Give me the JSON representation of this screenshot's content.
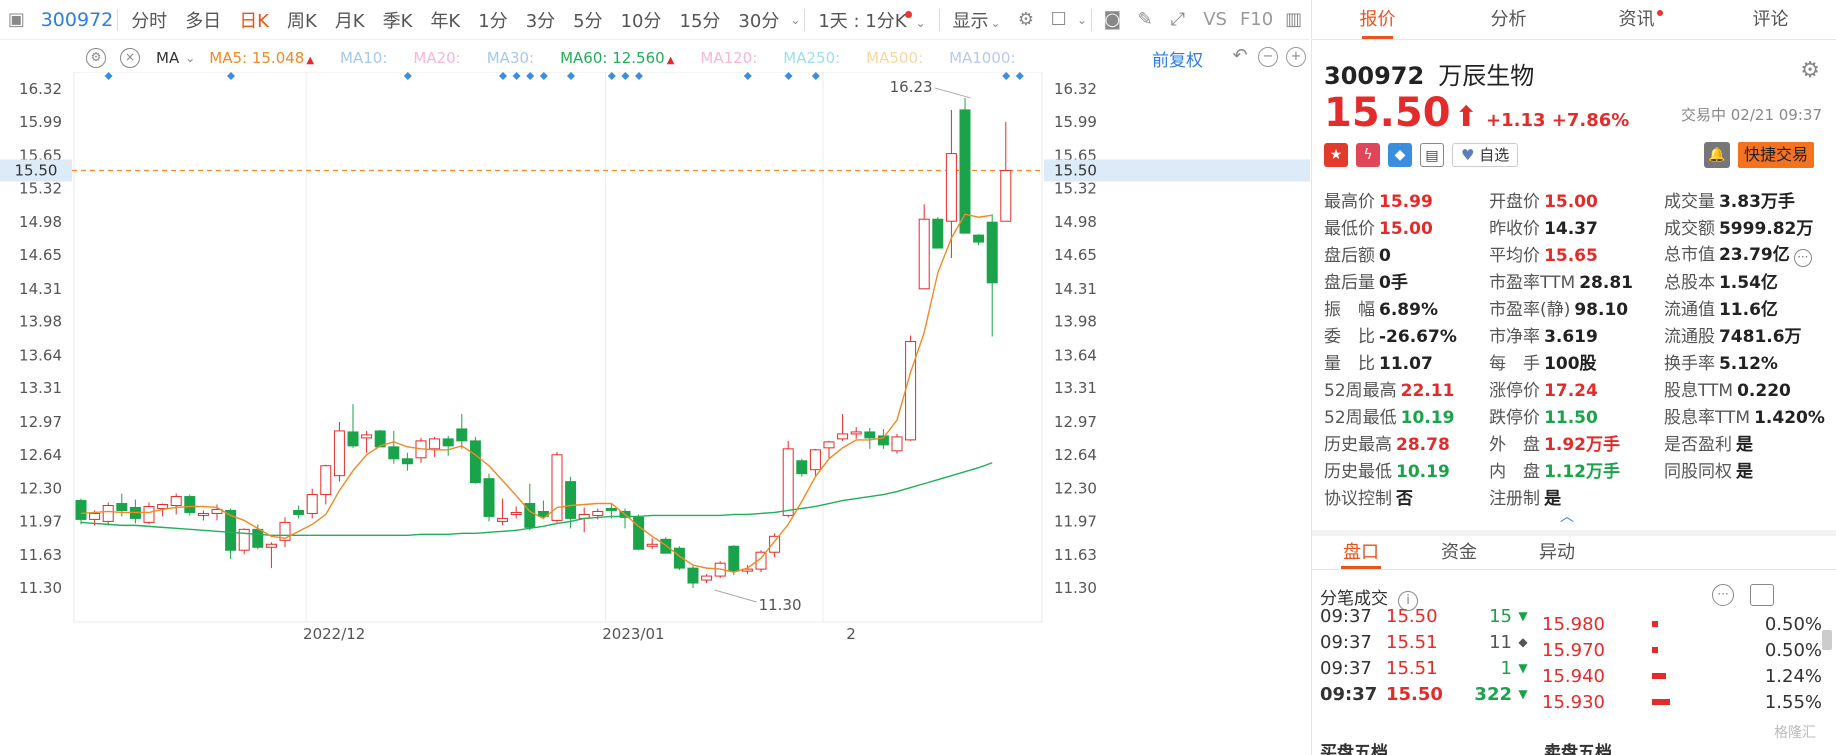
{
  "toolbar": {
    "code": "300972",
    "periods": [
      "分时",
      "多日",
      "日K",
      "周K",
      "月K",
      "季K",
      "年K",
      "1分",
      "3分",
      "5分",
      "10分",
      "15分",
      "30分"
    ],
    "active_period": "日K",
    "range_label": "1天 : 1分K",
    "display_label": "显示",
    "vs_label": "VS",
    "f10_label": "F10"
  },
  "ma_bar": {
    "name": "MA",
    "items": [
      {
        "label": "MA5:",
        "value": "15.048",
        "color": "#f08a24",
        "arrow": "▲"
      },
      {
        "label": "MA10:",
        "value": "",
        "color": "#a6c8f0",
        "arrow": ""
      },
      {
        "label": "MA20:",
        "value": "",
        "color": "#f5b8d8",
        "arrow": ""
      },
      {
        "label": "MA30:",
        "value": "",
        "color": "#a6c8f0",
        "arrow": ""
      },
      {
        "label": "MA60:",
        "value": "12.560",
        "color": "#20b05a",
        "arrow": "▲"
      },
      {
        "label": "MA120:",
        "value": "",
        "color": "#f5b8d8",
        "arrow": ""
      },
      {
        "label": "MA250:",
        "value": "",
        "color": "#9ee0e8",
        "arrow": ""
      },
      {
        "label": "MA500:",
        "value": "",
        "color": "#f5d8a0",
        "arrow": ""
      },
      {
        "label": "MA1000:",
        "value": "",
        "color": "#b8c8f0",
        "arrow": ""
      }
    ],
    "adjust_label": "前复权"
  },
  "chart_data": {
    "type": "candlestick",
    "y_ticks": [
      "16.32",
      "15.99",
      "15.65",
      "15.32",
      "14.98",
      "14.65",
      "14.31",
      "13.98",
      "13.64",
      "13.31",
      "12.97",
      "12.64",
      "12.30",
      "11.97",
      "11.63",
      "11.30"
    ],
    "ylim": [
      11.1,
      16.5
    ],
    "x_labels": [
      {
        "label": "2022/12",
        "index": 17
      },
      {
        "label": "2023/01",
        "index": 39
      },
      {
        "label": "2",
        "index": 55
      }
    ],
    "current_price": "15.50",
    "high_marker": {
      "label": "16.23",
      "index": 66,
      "value": 16.23
    },
    "low_marker": {
      "label": "11.30",
      "index": 46,
      "value": 11.3
    },
    "candles": [
      {
        "o": 12.18,
        "h": 12.2,
        "l": 11.94,
        "c": 11.99
      },
      {
        "o": 11.99,
        "h": 12.08,
        "l": 11.93,
        "c": 12.05
      },
      {
        "o": 11.97,
        "h": 12.16,
        "l": 11.93,
        "c": 12.13
      },
      {
        "o": 12.15,
        "h": 12.25,
        "l": 12.02,
        "c": 12.08
      },
      {
        "o": 12.11,
        "h": 12.19,
        "l": 11.95,
        "c": 12.0
      },
      {
        "o": 11.96,
        "h": 12.16,
        "l": 11.94,
        "c": 12.12
      },
      {
        "o": 12.1,
        "h": 12.15,
        "l": 12.02,
        "c": 12.14
      },
      {
        "o": 12.13,
        "h": 12.25,
        "l": 12.04,
        "c": 12.22
      },
      {
        "o": 12.22,
        "h": 12.24,
        "l": 12.03,
        "c": 12.06
      },
      {
        "o": 12.03,
        "h": 12.08,
        "l": 11.98,
        "c": 12.05
      },
      {
        "o": 12.05,
        "h": 12.14,
        "l": 11.98,
        "c": 12.09
      },
      {
        "o": 12.08,
        "h": 12.1,
        "l": 11.59,
        "c": 11.68
      },
      {
        "o": 11.68,
        "h": 11.9,
        "l": 11.64,
        "c": 11.89
      },
      {
        "o": 11.89,
        "h": 11.94,
        "l": 11.69,
        "c": 11.71
      },
      {
        "o": 11.71,
        "h": 11.76,
        "l": 11.5,
        "c": 11.74
      },
      {
        "o": 11.78,
        "h": 12.01,
        "l": 11.71,
        "c": 11.96
      },
      {
        "o": 12.08,
        "h": 12.13,
        "l": 12.0,
        "c": 12.04
      },
      {
        "o": 12.05,
        "h": 12.3,
        "l": 12.0,
        "c": 12.24
      },
      {
        "o": 12.24,
        "h": 12.54,
        "l": 12.14,
        "c": 12.53
      },
      {
        "o": 12.43,
        "h": 12.97,
        "l": 12.37,
        "c": 12.88
      },
      {
        "o": 12.87,
        "h": 13.15,
        "l": 12.71,
        "c": 12.73
      },
      {
        "o": 12.81,
        "h": 12.88,
        "l": 12.66,
        "c": 12.84
      },
      {
        "o": 12.88,
        "h": 12.89,
        "l": 12.72,
        "c": 12.72
      },
      {
        "o": 12.72,
        "h": 12.88,
        "l": 12.55,
        "c": 12.6
      },
      {
        "o": 12.6,
        "h": 12.66,
        "l": 12.48,
        "c": 12.55
      },
      {
        "o": 12.61,
        "h": 12.81,
        "l": 12.56,
        "c": 12.78
      },
      {
        "o": 12.7,
        "h": 12.82,
        "l": 12.62,
        "c": 12.8
      },
      {
        "o": 12.8,
        "h": 12.83,
        "l": 12.63,
        "c": 12.73
      },
      {
        "o": 12.9,
        "h": 13.05,
        "l": 12.7,
        "c": 12.78
      },
      {
        "o": 12.78,
        "h": 12.82,
        "l": 12.35,
        "c": 12.36
      },
      {
        "o": 12.4,
        "h": 12.45,
        "l": 11.97,
        "c": 12.02
      },
      {
        "o": 11.97,
        "h": 12.2,
        "l": 11.93,
        "c": 12.0
      },
      {
        "o": 12.04,
        "h": 12.12,
        "l": 12.0,
        "c": 12.06
      },
      {
        "o": 12.15,
        "h": 12.35,
        "l": 11.88,
        "c": 11.91
      },
      {
        "o": 12.07,
        "h": 12.18,
        "l": 12.0,
        "c": 12.02
      },
      {
        "o": 11.98,
        "h": 12.67,
        "l": 11.96,
        "c": 12.64
      },
      {
        "o": 12.37,
        "h": 12.42,
        "l": 11.9,
        "c": 12.0
      },
      {
        "o": 12.0,
        "h": 12.11,
        "l": 11.86,
        "c": 12.04
      },
      {
        "o": 12.03,
        "h": 12.1,
        "l": 11.99,
        "c": 12.07
      },
      {
        "o": 12.1,
        "h": 12.15,
        "l": 12.0,
        "c": 12.08
      },
      {
        "o": 12.07,
        "h": 12.1,
        "l": 11.9,
        "c": 12.01
      },
      {
        "o": 12.01,
        "h": 12.04,
        "l": 11.68,
        "c": 11.69
      },
      {
        "o": 11.72,
        "h": 11.8,
        "l": 11.69,
        "c": 11.74
      },
      {
        "o": 11.79,
        "h": 11.81,
        "l": 11.65,
        "c": 11.65
      },
      {
        "o": 11.7,
        "h": 11.72,
        "l": 11.48,
        "c": 11.5
      },
      {
        "o": 11.5,
        "h": 11.53,
        "l": 11.3,
        "c": 11.35
      },
      {
        "o": 11.38,
        "h": 11.44,
        "l": 11.35,
        "c": 11.42
      },
      {
        "o": 11.42,
        "h": 11.57,
        "l": 11.4,
        "c": 11.55
      },
      {
        "o": 11.72,
        "h": 11.73,
        "l": 11.43,
        "c": 11.47
      },
      {
        "o": 11.47,
        "h": 11.53,
        "l": 11.44,
        "c": 11.49
      },
      {
        "o": 11.49,
        "h": 11.68,
        "l": 11.46,
        "c": 11.66
      },
      {
        "o": 11.66,
        "h": 11.85,
        "l": 11.61,
        "c": 11.82
      },
      {
        "o": 12.03,
        "h": 12.78,
        "l": 12.01,
        "c": 12.7
      },
      {
        "o": 12.58,
        "h": 12.6,
        "l": 12.42,
        "c": 12.45
      },
      {
        "o": 12.49,
        "h": 12.7,
        "l": 12.43,
        "c": 12.69
      },
      {
        "o": 12.71,
        "h": 12.78,
        "l": 12.6,
        "c": 12.77
      },
      {
        "o": 12.8,
        "h": 13.05,
        "l": 12.78,
        "c": 12.85
      },
      {
        "o": 12.85,
        "h": 12.92,
        "l": 12.8,
        "c": 12.87
      },
      {
        "o": 12.87,
        "h": 12.91,
        "l": 12.7,
        "c": 12.81
      },
      {
        "o": 12.83,
        "h": 12.9,
        "l": 12.7,
        "c": 12.74
      },
      {
        "o": 12.68,
        "h": 12.85,
        "l": 12.65,
        "c": 12.82
      },
      {
        "o": 12.79,
        "h": 13.84,
        "l": 12.78,
        "c": 13.78
      },
      {
        "o": 14.31,
        "h": 15.16,
        "l": 14.31,
        "c": 15.01
      },
      {
        "o": 15.01,
        "h": 15.03,
        "l": 14.73,
        "c": 14.72
      },
      {
        "o": 14.99,
        "h": 16.11,
        "l": 14.62,
        "c": 15.67
      },
      {
        "o": 16.11,
        "h": 16.23,
        "l": 14.87,
        "c": 14.87
      },
      {
        "o": 14.85,
        "h": 14.86,
        "l": 14.75,
        "c": 14.78
      },
      {
        "o": 14.98,
        "h": 15.06,
        "l": 13.83,
        "c": 14.37
      },
      {
        "o": 14.99,
        "h": 15.99,
        "l": 15.0,
        "c": 15.5
      }
    ],
    "ma5": [
      12.05,
      12.06,
      12.07,
      12.06,
      12.06,
      12.06,
      12.09,
      12.11,
      12.12,
      12.12,
      12.11,
      12.03,
      11.98,
      11.9,
      11.82,
      11.8,
      11.87,
      11.94,
      12.04,
      12.28,
      12.48,
      12.64,
      12.73,
      12.77,
      12.72,
      12.7,
      12.69,
      12.69,
      12.73,
      12.64,
      12.53,
      12.38,
      12.23,
      12.07,
      12.0,
      12.11,
      12.13,
      12.14,
      12.15,
      12.15,
      12.04,
      11.92,
      11.82,
      11.73,
      11.62,
      11.53,
      11.5,
      11.49,
      11.46,
      11.5,
      11.6,
      11.77,
      11.94,
      12.17,
      12.42,
      12.6,
      12.71,
      12.79,
      12.79,
      12.81,
      12.99,
      13.47,
      13.87,
      14.47,
      14.82,
      15.06,
      15.03,
      15.05
    ],
    "ma60": [
      11.96,
      11.95,
      11.94,
      11.93,
      11.93,
      11.92,
      11.91,
      11.9,
      11.89,
      11.88,
      11.87,
      11.86,
      11.85,
      11.84,
      11.83,
      11.83,
      11.83,
      11.83,
      11.83,
      11.83,
      11.83,
      11.83,
      11.83,
      11.83,
      11.83,
      11.84,
      11.84,
      11.84,
      11.85,
      11.85,
      11.86,
      11.87,
      11.88,
      11.9,
      11.92,
      11.95,
      11.97,
      12.0,
      12.01,
      12.02,
      12.02,
      12.02,
      12.03,
      12.03,
      12.03,
      12.03,
      12.03,
      12.03,
      12.04,
      12.04,
      12.05,
      12.06,
      12.08,
      12.1,
      12.12,
      12.15,
      12.18,
      12.2,
      12.22,
      12.24,
      12.27,
      12.31,
      12.35,
      12.39,
      12.43,
      12.47,
      12.51,
      12.56
    ],
    "marker_indices": [
      1,
      10,
      23,
      30,
      31,
      32,
      33,
      35,
      38,
      39,
      40,
      48,
      51,
      53,
      67,
      68
    ]
  },
  "panel": {
    "tabs": [
      "报价",
      "分析",
      "资讯",
      "评论"
    ],
    "active_tab": "报价",
    "code": "300972",
    "name": "万辰生物",
    "price": "15.50",
    "change": "+1.13",
    "change_pct": "+7.86%",
    "status": "交易中 02/21 09:37",
    "watch_label": "自选",
    "fast_trade": "快捷交易",
    "quote_rows": [
      [
        {
          "l": "最高价",
          "v": "15.99",
          "c": "red"
        },
        {
          "l": "开盘价",
          "v": "15.00",
          "c": "red"
        },
        {
          "l": "成交量",
          "v": "3.83万手",
          "c": ""
        }
      ],
      [
        {
          "l": "最低价",
          "v": "15.00",
          "c": "red"
        },
        {
          "l": "昨收价",
          "v": "14.37",
          "c": ""
        },
        {
          "l": "成交额",
          "v": "5999.82万",
          "c": ""
        }
      ],
      [
        {
          "l": "盘后额",
          "v": "0",
          "c": ""
        },
        {
          "l": "平均价",
          "v": "15.65",
          "c": "red"
        },
        {
          "l": "总市值",
          "v": "23.79亿",
          "c": ""
        }
      ],
      [
        {
          "l": "盘后量",
          "v": "0手",
          "c": ""
        },
        {
          "l": "市盈率TTM",
          "v": "28.81",
          "c": ""
        },
        {
          "l": "总股本",
          "v": "1.54亿",
          "c": ""
        }
      ],
      [
        {
          "l": "振　幅",
          "v": "6.89%",
          "c": ""
        },
        {
          "l": "市盈率(静)",
          "v": "98.10",
          "c": ""
        },
        {
          "l": "流通值",
          "v": "11.6亿",
          "c": ""
        }
      ],
      [
        {
          "l": "委　比",
          "v": "-26.67%",
          "c": ""
        },
        {
          "l": "市净率",
          "v": "3.619",
          "c": ""
        },
        {
          "l": "流通股",
          "v": "7481.6万",
          "c": ""
        }
      ],
      [
        {
          "l": "量　比",
          "v": "11.07",
          "c": ""
        },
        {
          "l": "每　手",
          "v": "100股",
          "c": ""
        },
        {
          "l": "换手率",
          "v": "5.12%",
          "c": ""
        }
      ],
      [
        {
          "l": "52周最高",
          "v": "22.11",
          "c": "red"
        },
        {
          "l": "涨停价",
          "v": "17.24",
          "c": "red"
        },
        {
          "l": "股息TTM",
          "v": "0.220",
          "c": ""
        }
      ],
      [
        {
          "l": "52周最低",
          "v": "10.19",
          "c": "green"
        },
        {
          "l": "跌停价",
          "v": "11.50",
          "c": "green"
        },
        {
          "l": "股息率TTM",
          "v": "1.420%",
          "c": ""
        }
      ],
      [
        {
          "l": "历史最高",
          "v": "28.78",
          "c": "red"
        },
        {
          "l": "外　盘",
          "v": "1.92万手",
          "c": "red"
        },
        {
          "l": "是否盈利",
          "v": "是",
          "c": ""
        }
      ],
      [
        {
          "l": "历史最低",
          "v": "10.19",
          "c": "green"
        },
        {
          "l": "内　盘",
          "v": "1.12万手",
          "c": "green"
        },
        {
          "l": "同股同权",
          "v": "是",
          "c": ""
        }
      ],
      [
        {
          "l": "协议控制",
          "v": "否",
          "c": ""
        },
        {
          "l": "注册制",
          "v": "是",
          "c": ""
        },
        {
          "l": "",
          "v": "",
          "c": ""
        }
      ]
    ],
    "tabs2": [
      "盘口",
      "资金",
      "异动"
    ],
    "tick_title": "分笔成交",
    "ticks": [
      {
        "t": "09:37",
        "p": "15.50",
        "v": "15",
        "dir": "down"
      },
      {
        "t": "09:37",
        "p": "15.51",
        "v": "11",
        "dir": "flat"
      },
      {
        "t": "09:37",
        "p": "15.51",
        "v": "1",
        "dir": "down"
      },
      {
        "t": "09:37",
        "p": "15.50",
        "v": "322",
        "dir": "down"
      }
    ],
    "depth": [
      {
        "p": "15.980",
        "pct": "0.50%",
        "w": 0.06
      },
      {
        "p": "15.970",
        "pct": "0.50%",
        "w": 0.06
      },
      {
        "p": "15.940",
        "pct": "1.24%",
        "w": 0.14
      },
      {
        "p": "15.930",
        "pct": "1.55%",
        "w": 0.18
      }
    ],
    "foot_buy": "买盘五档",
    "foot_sell": "卖盘五档",
    "watermark": "格隆汇"
  },
  "colors": {
    "up": "#e42b2b",
    "down": "#1aa34a",
    "ma5": "#f08a24",
    "ma60": "#20b05a",
    "accent": "#e8541e",
    "link": "#2f7de1"
  }
}
